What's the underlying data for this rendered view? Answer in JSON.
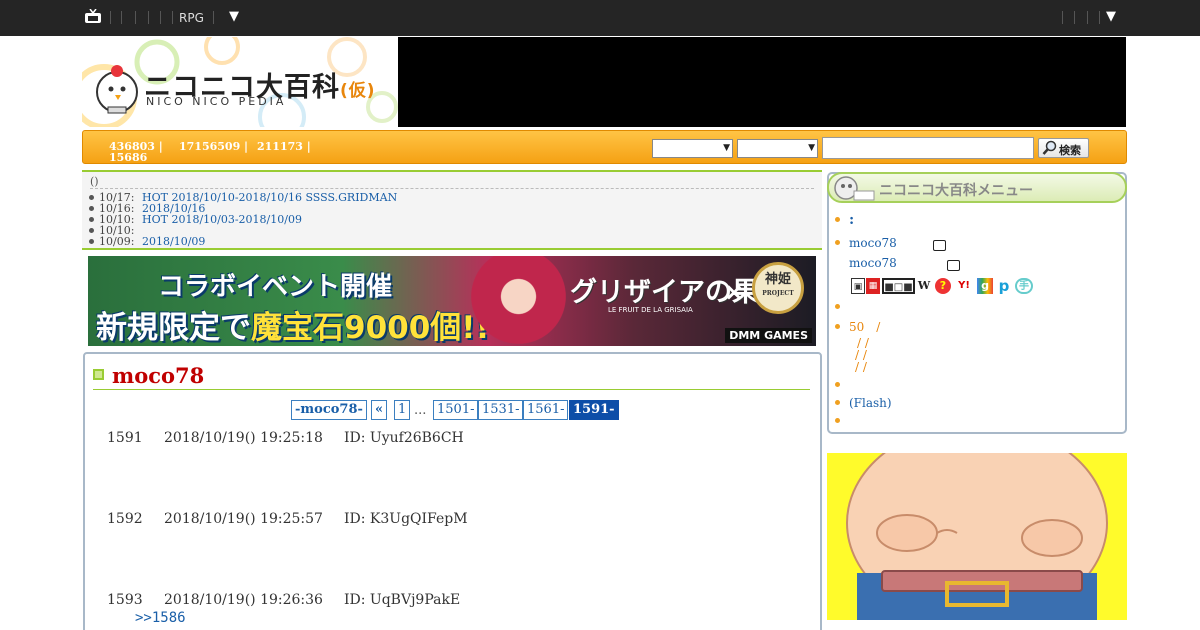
{
  "topbar": {
    "rpg_label": "RPG",
    "caret": "▼",
    "caret_right": "▼"
  },
  "header": {
    "logo_title": "ニコニコ大百科",
    "logo_tag": "(仮)",
    "logo_subtitle": "NICO NICO PEDIA"
  },
  "stats": {
    "stat1": "436803 |",
    "stat2": "17156509 |",
    "stat3": "211173 |",
    "stat4": "15686",
    "search_button": "検索",
    "select_arrow": "▼"
  },
  "news": {
    "heading": "()",
    "items": [
      {
        "date": "10/17:",
        "text": "HOT 2018/10/10-2018/10/16 SSSS.GRIDMAN"
      },
      {
        "date": "10/16:",
        "text": "2018/10/16"
      },
      {
        "date": "10/10:",
        "text": "HOT 2018/10/03-2018/10/09"
      },
      {
        "date": "10/10:",
        "text": ""
      },
      {
        "date": "10/09:",
        "text": "2018/10/09"
      }
    ]
  },
  "banner": {
    "line1": "コラボイベント開催",
    "line2_a": "新規限定で",
    "line2_b": "魔宝石9000個!!",
    "game_title": "グリザイアの果実",
    "game_sub": "LE FRUIT DE LA GRISAIA",
    "cross": "×",
    "seal_main": "神姫",
    "seal_sub": "PROJECT",
    "publisher": "DMM GAMES"
  },
  "article": {
    "title": "moco78",
    "pager": [
      {
        "label": "-moco78-",
        "type": "bold"
      },
      {
        "label": "«",
        "type": "bold"
      },
      {
        "label": "1",
        "type": "plain"
      },
      {
        "label": "1501-",
        "type": "plain"
      },
      {
        "label": "1531-",
        "type": "plain"
      },
      {
        "label": "1561-",
        "type": "plain"
      },
      {
        "label": "1591-",
        "type": "current"
      }
    ],
    "pager_dots": "...",
    "responses": [
      {
        "num": "1591",
        "datetime": "2018/10/19() 19:25:18",
        "id": "ID: Uyuf26B6CH"
      },
      {
        "num": "1592",
        "datetime": "2018/10/19() 19:25:57",
        "id": "ID: K3UgQIFepM"
      },
      {
        "num": "1593",
        "datetime": "2018/10/19() 19:26:36",
        "id": "ID: UqBVj9PakE"
      }
    ],
    "reply_link": ">>1586"
  },
  "sidebar_menu": {
    "title": "ニコニコ大百科メニュー",
    "colon": ":",
    "item_moco_1": "moco78",
    "item_moco_2": "moco78",
    "item_50": "50　/",
    "item_slashes_1": "/ /",
    "item_slashes_2": "/ /",
    "item_slashes_3": "/ /",
    "item_flash": "(Flash)",
    "icon_w": "W",
    "icon_y": "Y!"
  },
  "colors": {
    "accent_orange": "#f5a114",
    "title_red": "#c00000",
    "link_blue": "#1a5fa8",
    "green_border": "#99cc33"
  }
}
